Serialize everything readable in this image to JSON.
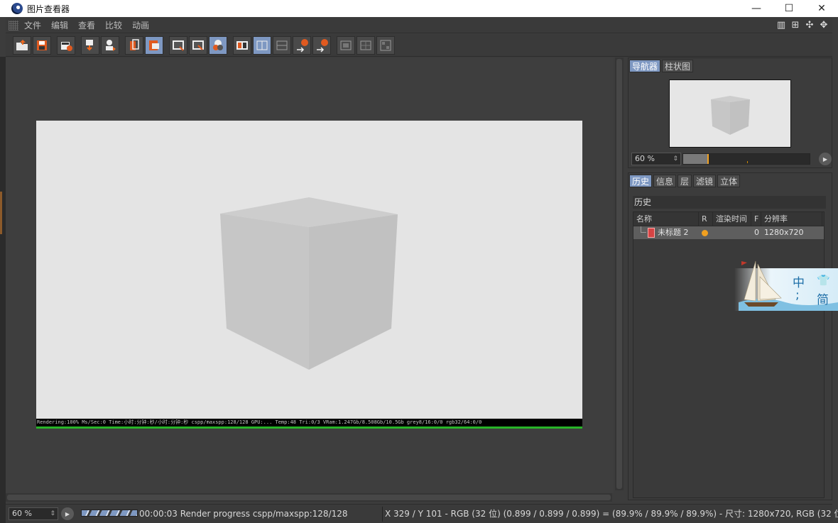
{
  "window": {
    "title": "图片查看器",
    "controls": {
      "minimize": "—",
      "maximize": "☐",
      "close": "✕"
    }
  },
  "menu": {
    "items": [
      "文件",
      "编辑",
      "查看",
      "比较",
      "动画"
    ]
  },
  "layout_icons": [
    "split-panel-icon",
    "new-panel-icon",
    "move-panel-icon",
    "arrange-icon"
  ],
  "toolbar": {
    "groups": [
      [
        "open-image-icon",
        "save-image-icon"
      ],
      [
        "render-settings-icon"
      ],
      [
        "import-icon",
        "export-icon"
      ],
      [
        "copy-to-picture-icon",
        "crop-icon"
      ],
      [
        "frame-view-icon",
        "fit-view-icon",
        "region-icon"
      ],
      [
        "ab-compare-icon",
        "ab-split-icon",
        "ab-overlay-icon",
        "set-a-icon",
        "set-b-icon"
      ],
      [
        "channel-1-icon",
        "channel-2-icon",
        "channel-3-icon"
      ]
    ],
    "active": [
      "crop-icon",
      "region-icon",
      "ab-split-icon"
    ]
  },
  "render": {
    "strip": "Rendering:100%  Ms/Sec:0  Time:小时:分钟:秒/小时:分钟:秒  cspp/maxspp:128/128  GPU:...  Temp:48  Tri:0/3  VRam:1.247Gb/8.508Gb/10.5Gb  grey8/16:0/0  rgb32/64:0/0",
    "background_color": "#e4e4e4",
    "cube_colors": {
      "left": "#c6c6c6",
      "right": "#c1c1c1",
      "top": "#cdcdcd"
    }
  },
  "navigator": {
    "tabs": [
      "导航器",
      "柱状图"
    ],
    "active_tab": 0,
    "zoom": "60 %",
    "zoom_level_fraction": 0.19
  },
  "history": {
    "tabs": [
      "历史",
      "信息",
      "层",
      "滤镜",
      "立体"
    ],
    "active_tab": 0,
    "header": "历史",
    "columns": [
      "名称",
      "R",
      "渲染时间",
      "F",
      "分辨率"
    ],
    "rows": [
      {
        "name": "未标题 2",
        "r": "",
        "render_time": "",
        "f": "0",
        "resolution": "1280x720"
      }
    ]
  },
  "watermark": {
    "char1": "中",
    "char2": "简",
    "char3": ";"
  },
  "status": {
    "zoom": "60 %",
    "progress_text": "00:00:03 Render progress  cspp/maxspp:128/128",
    "pixel_info": "X 329 / Y 101 - RGB (32 位) (0.899 / 0.899 / 0.899) = (89.9% / 89.9% / 89.9%) - 尺寸: 1280x720, RGB (32 位)"
  },
  "colors": {
    "accent": "#7e98c2",
    "progress_green": "#28b428",
    "status_orange": "#f0a020"
  }
}
